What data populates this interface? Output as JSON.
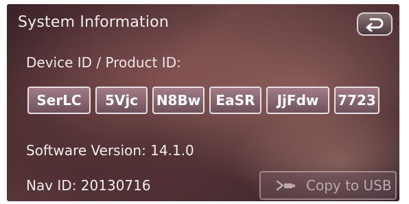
{
  "screen": {
    "title": "System Information"
  },
  "back_button": {
    "icon": "return-arrow-icon"
  },
  "device": {
    "label": "Device ID / Product ID:",
    "ids": [
      "SerLC",
      "5Vjc",
      "N8Bw",
      "EaSR",
      "JjFdw",
      "7723"
    ]
  },
  "software": {
    "version_text": "Software Version: 14.1.0"
  },
  "nav": {
    "id_text": "Nav ID: 20130716"
  },
  "usb_button": {
    "label": "Copy to USB",
    "icon": "usb-copy-icon"
  },
  "colors": {
    "text": "#f2eef0",
    "chip_fill": "#8c6a74",
    "disabled_text": "#b9a9b0"
  }
}
